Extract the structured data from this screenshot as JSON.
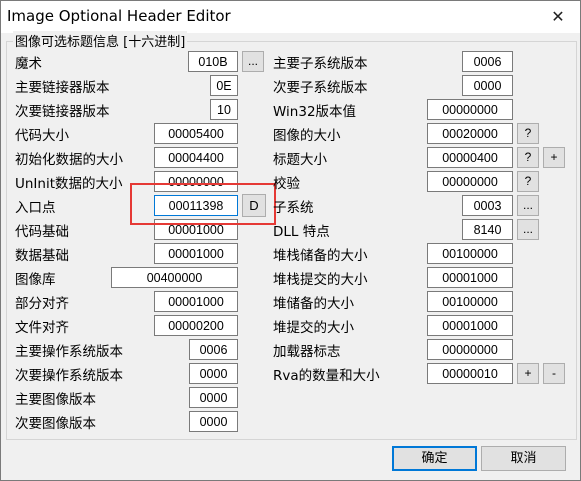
{
  "window": {
    "title": "Image Optional Header Editor",
    "close_glyph": "✕"
  },
  "group": {
    "label": "图像可选标题信息 [十六进制]"
  },
  "left": [
    {
      "label": "魔术",
      "value": "010B"
    },
    {
      "label": "主要链接器版本",
      "value": "0E"
    },
    {
      "label": "次要链接器版本",
      "value": "10"
    },
    {
      "label": "代码大小",
      "value": "00005400"
    },
    {
      "label": "初始化数据的大小",
      "value": "00004400"
    },
    {
      "label": "UnInit数据的大小",
      "value": "00000000"
    },
    {
      "label": "入口点",
      "value": "00011398"
    },
    {
      "label": "代码基础",
      "value": "00001000"
    },
    {
      "label": "数据基础",
      "value": "00001000"
    },
    {
      "label": "图像库",
      "value": "00400000"
    },
    {
      "label": "部分对齐",
      "value": "00001000"
    },
    {
      "label": "文件对齐",
      "value": "00000200"
    },
    {
      "label": "主要操作系统版本",
      "value": "0006"
    },
    {
      "label": "次要操作系统版本",
      "value": "0000"
    },
    {
      "label": "主要图像版本",
      "value": "0000"
    },
    {
      "label": "次要图像版本",
      "value": "0000"
    }
  ],
  "right": [
    {
      "label": "主要子系统版本",
      "value": "0006"
    },
    {
      "label": "次要子系统版本",
      "value": "0000"
    },
    {
      "label": "Win32版本值",
      "value": "00000000"
    },
    {
      "label": "图像的大小",
      "value": "00020000"
    },
    {
      "label": "标题大小",
      "value": "00000400"
    },
    {
      "label": "校验",
      "value": "00000000"
    },
    {
      "label": "子系统",
      "value": "0003"
    },
    {
      "label": "DLL 特点",
      "value": "8140"
    },
    {
      "label": "堆栈储备的大小",
      "value": "00100000"
    },
    {
      "label": "堆栈提交的大小",
      "value": "00001000"
    },
    {
      "label": "堆储备的大小",
      "value": "00100000"
    },
    {
      "label": "堆提交的大小",
      "value": "00001000"
    },
    {
      "label": "加载器标志",
      "value": "00000000"
    },
    {
      "label": "Rva的数量和大小",
      "value": "00000010"
    }
  ],
  "buttons": {
    "ellipsis": "...",
    "help": "?",
    "plus": "+",
    "minus": "-",
    "d": "D",
    "ok": "确定",
    "cancel": "取消"
  }
}
